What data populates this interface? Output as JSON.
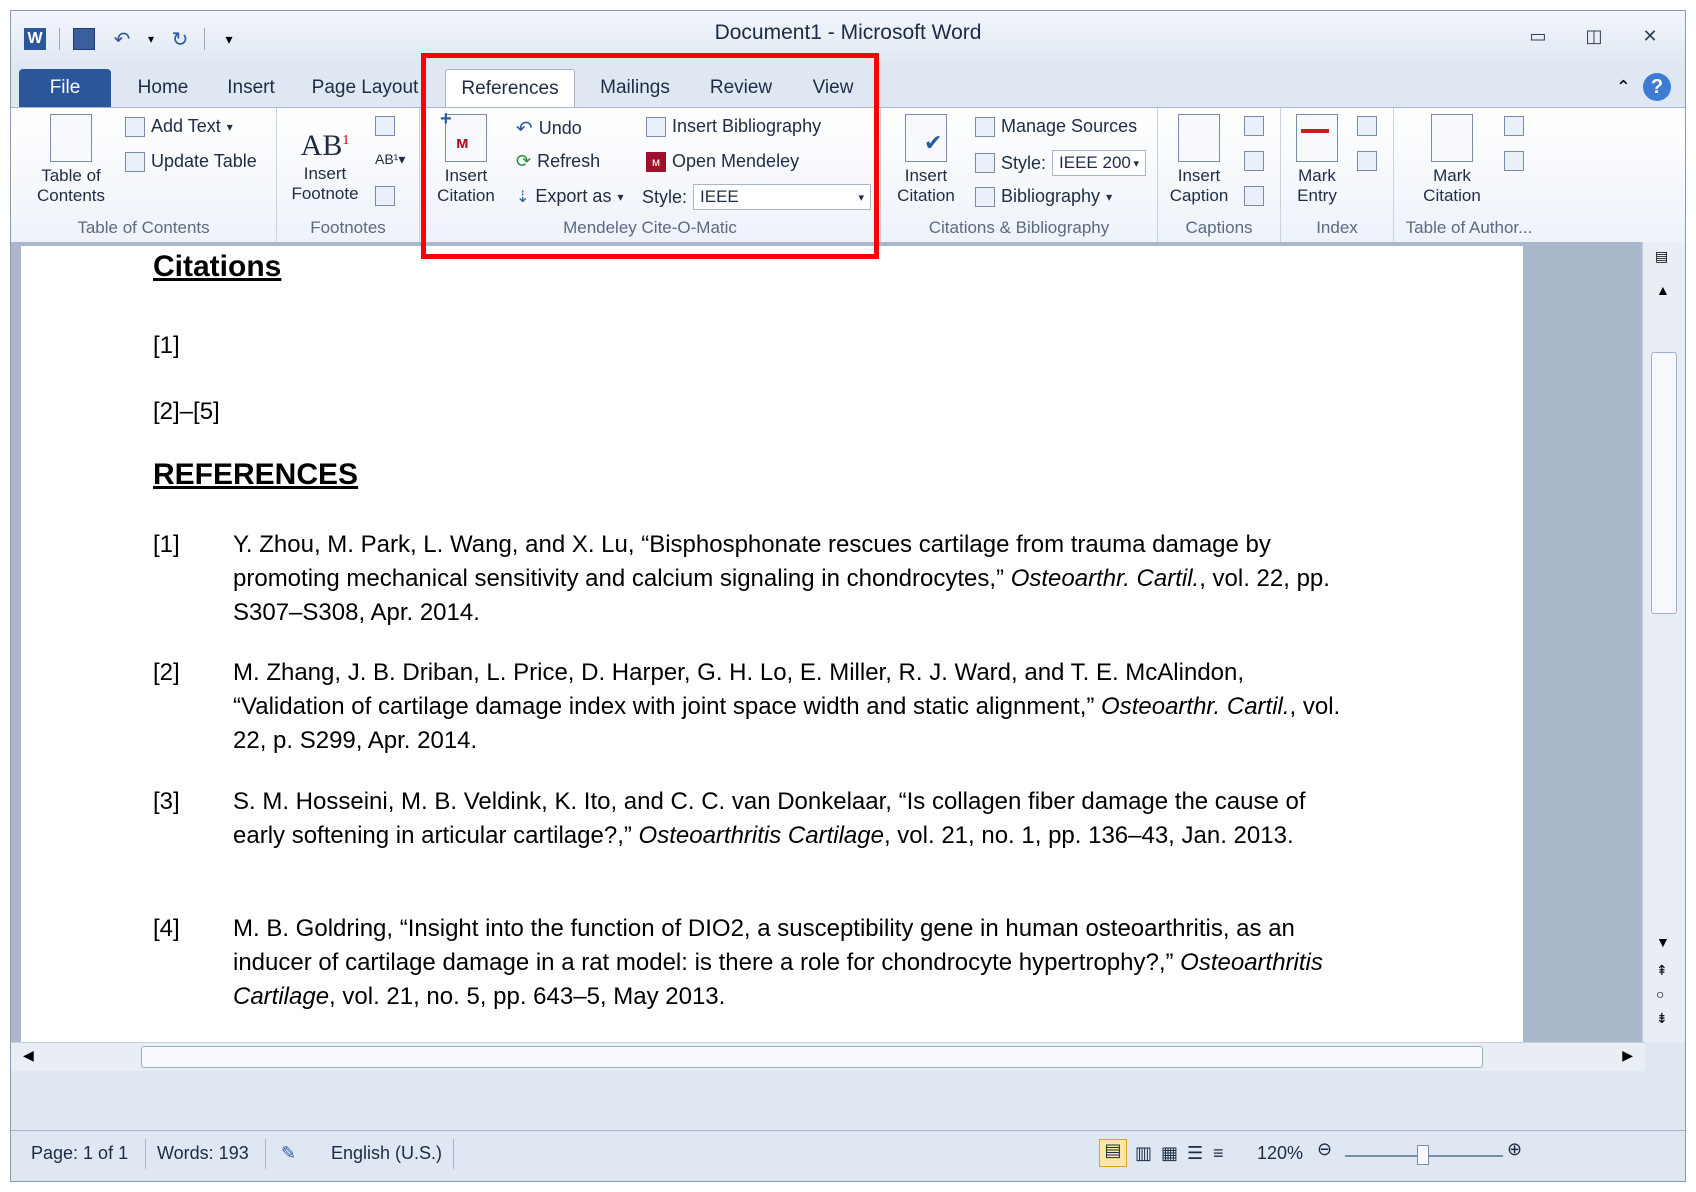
{
  "window": {
    "title": "Document1 - Microsoft Word"
  },
  "tabs": [
    "File",
    "Home",
    "Insert",
    "Page Layout",
    "References",
    "Mailings",
    "Review",
    "View"
  ],
  "active_tab": "References",
  "ribbon": {
    "toc": {
      "table_of_contents": "Table of Contents",
      "add_text": "Add Text",
      "update_table": "Update Table",
      "group": "Table of Contents"
    },
    "footnotes": {
      "insert_footnote": "Insert Footnote",
      "group": "Footnotes"
    },
    "mendeley": {
      "insert_citation": "Insert Citation",
      "undo": "Undo",
      "refresh": "Refresh",
      "export_as": "Export as",
      "insert_bibliography": "Insert Bibliography",
      "open_mendeley": "Open Mendeley",
      "style_label": "Style:",
      "style_value": "IEEE",
      "group": "Mendeley Cite-O-Matic"
    },
    "citations": {
      "insert_citation": "Insert Citation",
      "manage_sources": "Manage Sources",
      "style_label": "Style:",
      "style_value": "IEEE 200",
      "bibliography": "Bibliography",
      "group": "Citations & Bibliography"
    },
    "captions": {
      "insert_caption": "Insert Caption",
      "group": "Captions"
    },
    "index": {
      "mark_entry": "Mark Entry",
      "group": "Index"
    },
    "authorities": {
      "mark_citation": "Mark Citation",
      "group": "Table of Author..."
    }
  },
  "document": {
    "citations_heading": "Citations",
    "citation_1": "[1]",
    "citation_2": "[2]–[5]",
    "references_heading": "REFERENCES",
    "references": [
      {
        "num": "[1]",
        "pre": "Y. Zhou, M. Park, L. Wang, and X. Lu, “Bisphosphonate rescues cartilage from trauma damage by promoting mechanical sensitivity and calcium signaling in chondrocytes,” ",
        "journal": "Osteoarthr. Cartil.",
        "post": ", vol. 22, pp. S307–S308, Apr. 2014."
      },
      {
        "num": "[2]",
        "pre": "M. Zhang, J. B. Driban, L. Price, D. Harper, G. H. Lo, E. Miller, R. J. Ward, and T. E. McAlindon, “Validation of cartilage damage index with joint space width and static alignment,” ",
        "journal": "Osteoarthr. Cartil.",
        "post": ", vol. 22, p. S299, Apr. 2014."
      },
      {
        "num": "[3]",
        "pre": "S. M. Hosseini, M. B. Veldink, K. Ito, and C. C. van Donkelaar, “Is collagen fiber damage the cause of early softening in articular cartilage?,” ",
        "journal": "Osteoarthritis Cartilage",
        "post": ", vol. 21, no. 1, pp. 136–43, Jan. 2013."
      },
      {
        "num": "[4]",
        "pre": "M. B. Goldring, “Insight into the function of DIO2, a susceptibility gene in human osteoarthritis, as an inducer of cartilage damage in a rat model: is there a role for chondrocyte hypertrophy?,” ",
        "journal": "Osteoarthritis Cartilage",
        "post": ", vol. 21, no. 5, pp. 643–5, May 2013."
      }
    ]
  },
  "status": {
    "page": "Page: 1 of 1",
    "words": "Words: 193",
    "language": "English (U.S.)",
    "zoom": "120%"
  },
  "colors": {
    "file_tab": "#2b579a",
    "highlight": "#ff0000"
  }
}
